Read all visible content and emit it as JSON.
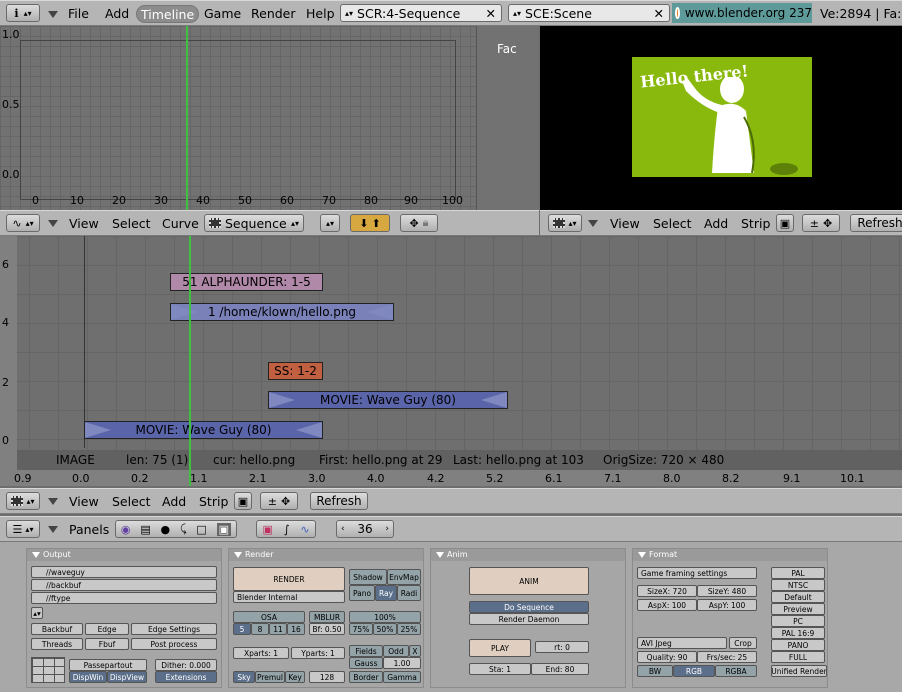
{
  "top_menu": {
    "items": [
      "File",
      "Add",
      "Timeline",
      "Game",
      "Render",
      "Help"
    ],
    "active": "Timeline",
    "screen": "SCR:4-Sequence",
    "scene": "SCE:Scene",
    "url": "www.blender.org 237",
    "status": "Ve:2894 | Fa:"
  },
  "ipo": {
    "y_ticks": [
      "1.0",
      "0.5",
      "0.0"
    ],
    "x_ticks": [
      "0",
      "10",
      "20",
      "30",
      "40",
      "50",
      "60",
      "70",
      "80",
      "90",
      "100"
    ],
    "channel": "Fac",
    "header": {
      "view": "View",
      "select": "Select",
      "curve": "Curve",
      "type": "Sequence"
    }
  },
  "preview": {
    "image_text": "Hello there!",
    "header": {
      "view": "View",
      "select": "Select",
      "add": "Add",
      "strip": "Strip",
      "refresh": "Refresh"
    }
  },
  "sequencer": {
    "y_ticks": [
      "6",
      "4",
      "2",
      "0"
    ],
    "x_ticks": [
      "0.9",
      "0.0",
      "0.2",
      "1.1",
      "2.1",
      "3.0",
      "4.0",
      "4.2",
      "5.2",
      "6.1",
      "7.1",
      "8.0",
      "8.2",
      "9.1",
      "10.1"
    ],
    "strips": {
      "s1": "51 ALPHAUNDER: 1-5",
      "s2": "1 /home/klown/hello.png",
      "s3": "SS: 1-2",
      "s4": "MOVIE: Wave Guy (80)",
      "s5": "MOVIE: Wave Guy (80)"
    },
    "info": {
      "type": "IMAGE",
      "len": "len: 75 (1)",
      "cur": "cur: hello.png",
      "first": "First: hello.png at 29",
      "last": "Last: hello.png at 103",
      "orig": "OrigSize: 720 × 480"
    },
    "header": {
      "view": "View",
      "select": "Select",
      "add": "Add",
      "strip": "Strip",
      "refresh": "Refresh"
    }
  },
  "buttons": {
    "header": {
      "panels": "Panels",
      "frame": "36"
    },
    "output": {
      "title": "Output",
      "paths": [
        "//waveguy",
        "//backbuf",
        "//ftype"
      ],
      "backbuf": "Backbuf",
      "edge": "Edge",
      "edge_settings": "Edge Settings",
      "threads": "Threads",
      "fbuf": "Fbuf",
      "post_process": "Post process",
      "passepartout": "Passepartout",
      "dither": "Dither: 0.000",
      "dispwin": "DispWin",
      "dispview": "DispView",
      "extensions": "Extensions"
    },
    "render": {
      "title": "Render",
      "render": "RENDER",
      "engine": "Blender Internal",
      "shadow": "Shadow",
      "envmap": "EnvMap",
      "pano": "Pano",
      "ray": "Ray",
      "radi": "Radi",
      "osa": "OSA",
      "osa_vals": [
        "5",
        "8",
        "11",
        "16"
      ],
      "mblur": "MBLUR",
      "bf": "Bf: 0.50",
      "pct": "100%",
      "pcts": [
        "75%",
        "50%",
        "25%"
      ],
      "xparts": "Xparts: 1",
      "yparts": "Yparts: 1",
      "fields": "Fields",
      "odd": "Odd",
      "x": "X",
      "gauss": "Gauss",
      "gval": "1.00",
      "sky": "Sky",
      "premul": "Premul",
      "key": "Key",
      "depth": "128",
      "border": "Border",
      "gamma": "Gamma"
    },
    "anim": {
      "title": "Anim",
      "anim": "ANIM",
      "do_sequence": "Do Sequence",
      "render_daemon": "Render Daemon",
      "play": "PLAY",
      "rt": "rt: 0",
      "sta": "Sta: 1",
      "end": "End: 80"
    },
    "format": {
      "title": "Format",
      "game_framing": "Game framing settings",
      "sizex": "SizeX: 720",
      "sizey": "SizeY: 480",
      "aspx": "AspX: 100",
      "aspy": "AspY: 100",
      "codec": "AVI Jpeg",
      "crop": "Crop",
      "quality": "Quality: 90",
      "frs": "Frs/sec: 25",
      "bw": "BW",
      "rgb": "RGB",
      "rgba": "RGBA",
      "presets": [
        "PAL",
        "NTSC",
        "Default",
        "Preview",
        "PC",
        "PAL 16:9",
        "PANO",
        "FULL",
        "Unified Render"
      ]
    }
  }
}
